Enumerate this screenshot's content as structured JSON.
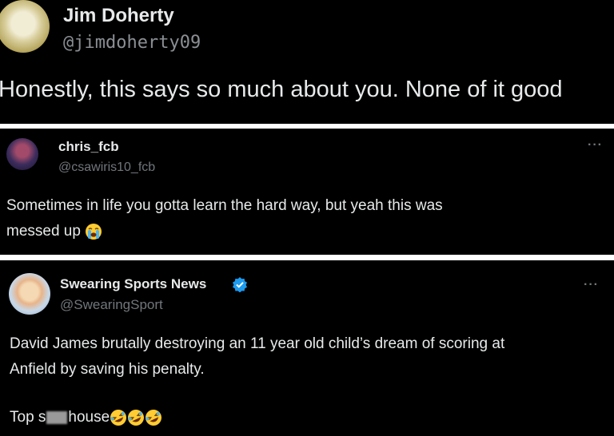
{
  "tweet1": {
    "name": "Jim Doherty",
    "handle": "@jimdoherty09",
    "text": "Honestly, this says so much about you. None of it good"
  },
  "tweet2": {
    "name": "chris_fcb",
    "handle": "@csawiris10_fcb",
    "more": "···",
    "text_line1": "Sometimes in life you gotta learn the hard way, but yeah this was",
    "text_line2": "messed up",
    "emoji": "loudly-crying-face-icon"
  },
  "tweet3": {
    "name": "Swearing Sports News",
    "verified": true,
    "handle": "@SwearingSport",
    "more": "···",
    "text_line1": "David James brutally destroying an 11 year old child’s dream of scoring at",
    "text_line2": "Anfield by saving his penalty.",
    "text_line3_start": "Top s",
    "text_line3_end": "house",
    "emoji": "rolling-on-floor-laughing-icon",
    "emoji_count": 3
  },
  "colors": {
    "background": "#000000",
    "divider": "#ffffff",
    "text": "#e7e9ea",
    "muted": "#71767b",
    "verified": "#1d9bf0"
  }
}
